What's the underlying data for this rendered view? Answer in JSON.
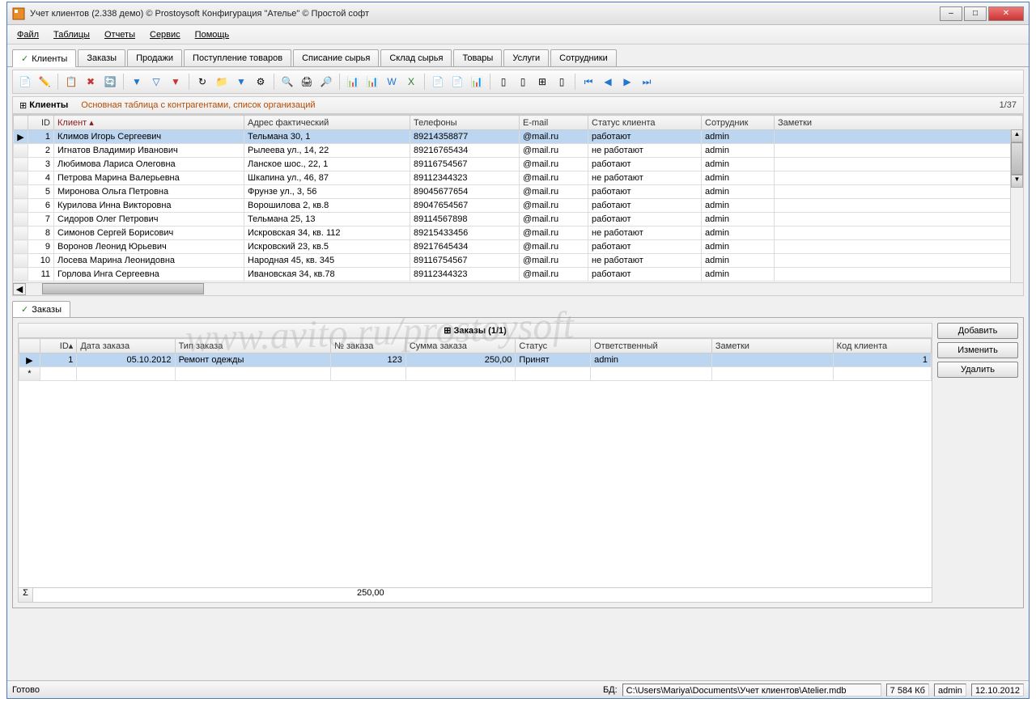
{
  "window": {
    "title": "Учет клиентов (2.338 демо) © Prostoysoft  Конфигурация \"Ателье\" © Простой софт"
  },
  "menu": {
    "file": "Файл",
    "tables": "Таблицы",
    "reports": "Отчеты",
    "service": "Сервис",
    "help": "Помощь"
  },
  "tabs": {
    "clients": "Клиенты",
    "orders": "Заказы",
    "sales": "Продажи",
    "supplies": "Поступление товаров",
    "writeoff": "Списание сырья",
    "stock": "Склад сырья",
    "goods": "Товары",
    "services": "Услуги",
    "staff": "Сотрудники"
  },
  "header": {
    "title": "Клиенты",
    "desc": "Основная таблица с контрагентами, список организаций",
    "counter": "1/37"
  },
  "cols": {
    "id": "ID",
    "client": "Клиент",
    "address": "Адрес фактический",
    "phones": "Телефоны",
    "email": "E-mail",
    "status": "Статус клиента",
    "employee": "Сотрудник",
    "notes": "Заметки"
  },
  "rows": [
    {
      "id": "1",
      "name": "Климов Игорь Сергеевич",
      "addr": "Тельмана 30, 1",
      "phone": "89214358877",
      "email": "@mail.ru",
      "status": "работают",
      "emp": "admin"
    },
    {
      "id": "2",
      "name": "Игнатов Владимир Иванович",
      "addr": "Рылеева ул., 14, 22",
      "phone": "89216765434",
      "email": "@mail.ru",
      "status": "не работают",
      "emp": "admin"
    },
    {
      "id": "3",
      "name": "Любимова Лариса Олеговна",
      "addr": "Ланское шос., 22, 1",
      "phone": "89116754567",
      "email": "@mail.ru",
      "status": "работают",
      "emp": "admin"
    },
    {
      "id": "4",
      "name": "Петрова Марина Валерьевна",
      "addr": "Шкапина ул., 46, 87",
      "phone": "89112344323",
      "email": "@mail.ru",
      "status": "не работают",
      "emp": "admin"
    },
    {
      "id": "5",
      "name": "Миронова Ольга Петровна",
      "addr": "Фрунзе ул., 3, 56",
      "phone": "89045677654",
      "email": "@mail.ru",
      "status": "работают",
      "emp": "admin"
    },
    {
      "id": "6",
      "name": "Курилова Инна Викторовна",
      "addr": "Ворошилова 2, кв.8",
      "phone": "89047654567",
      "email": "@mail.ru",
      "status": "работают",
      "emp": "admin"
    },
    {
      "id": "7",
      "name": "Сидоров Олег Петрович",
      "addr": "Тельмана 25,  13",
      "phone": "89114567898",
      "email": "@mail.ru",
      "status": "работают",
      "emp": "admin"
    },
    {
      "id": "8",
      "name": "Симонов Сергей Борисович",
      "addr": "Искровская 34, кв. 112",
      "phone": "89215433456",
      "email": "@mail.ru",
      "status": "не работают",
      "emp": "admin"
    },
    {
      "id": "9",
      "name": "Воронов Леонид Юрьевич",
      "addr": "Искровский 23, кв.5",
      "phone": "89217645434",
      "email": "@mail.ru",
      "status": "работают",
      "emp": "admin"
    },
    {
      "id": "10",
      "name": "Лосева Марина Леонидовна",
      "addr": "Народная 45, кв. 345",
      "phone": "89116754567",
      "email": "@mail.ru",
      "status": "не работают",
      "emp": "admin"
    },
    {
      "id": "11",
      "name": "Горлова Инга Сергеевна",
      "addr": "Ивановская 34, кв.78",
      "phone": "89112344323",
      "email": "@mail.ru",
      "status": "работают",
      "emp": "admin"
    }
  ],
  "subtab": {
    "orders": "Заказы"
  },
  "subheader": {
    "title": "⊞  Заказы (1/1)"
  },
  "subcols": {
    "id": "ID",
    "date": "Дата заказа",
    "type": "Тип заказа",
    "num": "№ заказа",
    "sum": "Сумма заказа",
    "status": "Статус",
    "resp": "Ответственный",
    "notes": "Заметки",
    "client_code": "Код клиента"
  },
  "subrows": [
    {
      "id": "1",
      "date": "05.10.2012",
      "type": "Ремонт одежды",
      "num": "123",
      "sum": "250,00",
      "status": "Принят",
      "resp": "admin",
      "notes": "",
      "code": "1"
    }
  ],
  "sumrow": {
    "sum": "250,00"
  },
  "sidebtns": {
    "add": "Добавить",
    "edit": "Изменить",
    "del": "Удалить"
  },
  "status": {
    "ready": "Готово",
    "db_label": "БД:",
    "db_path": "C:\\Users\\Mariya\\Documents\\Учет клиентов\\Atelier.mdb",
    "size": "7 584 Кб",
    "user": "admin",
    "date": "12.10.2012"
  },
  "watermark": "www.avito.ru/prostoysoft"
}
